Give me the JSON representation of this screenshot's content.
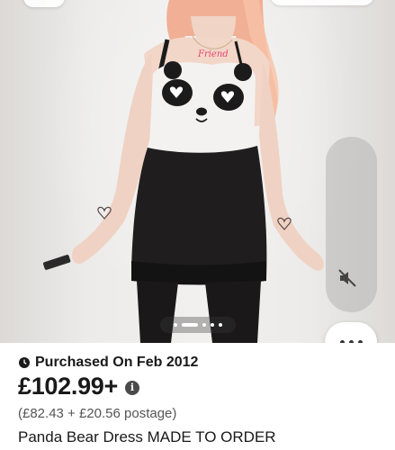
{
  "listing": {
    "status_label": "Purchased On Feb 2012",
    "price": "£102.99+",
    "price_breakdown": "(£82.43 + £20.56 postage)",
    "title": "Panda Bear Dress MADE TO ORDER"
  },
  "gallery": {
    "image_count": 5,
    "active_index": 1
  },
  "icons": {
    "status": "clock-icon",
    "price_info": "info-icon",
    "sound": "speaker-muted-icon",
    "more": "more-horizontal-icon"
  },
  "colors": {
    "text": "#191919",
    "muted_text": "#555555",
    "dress_black": "#1c1b1b",
    "panda_white": "#f4f2f0"
  }
}
